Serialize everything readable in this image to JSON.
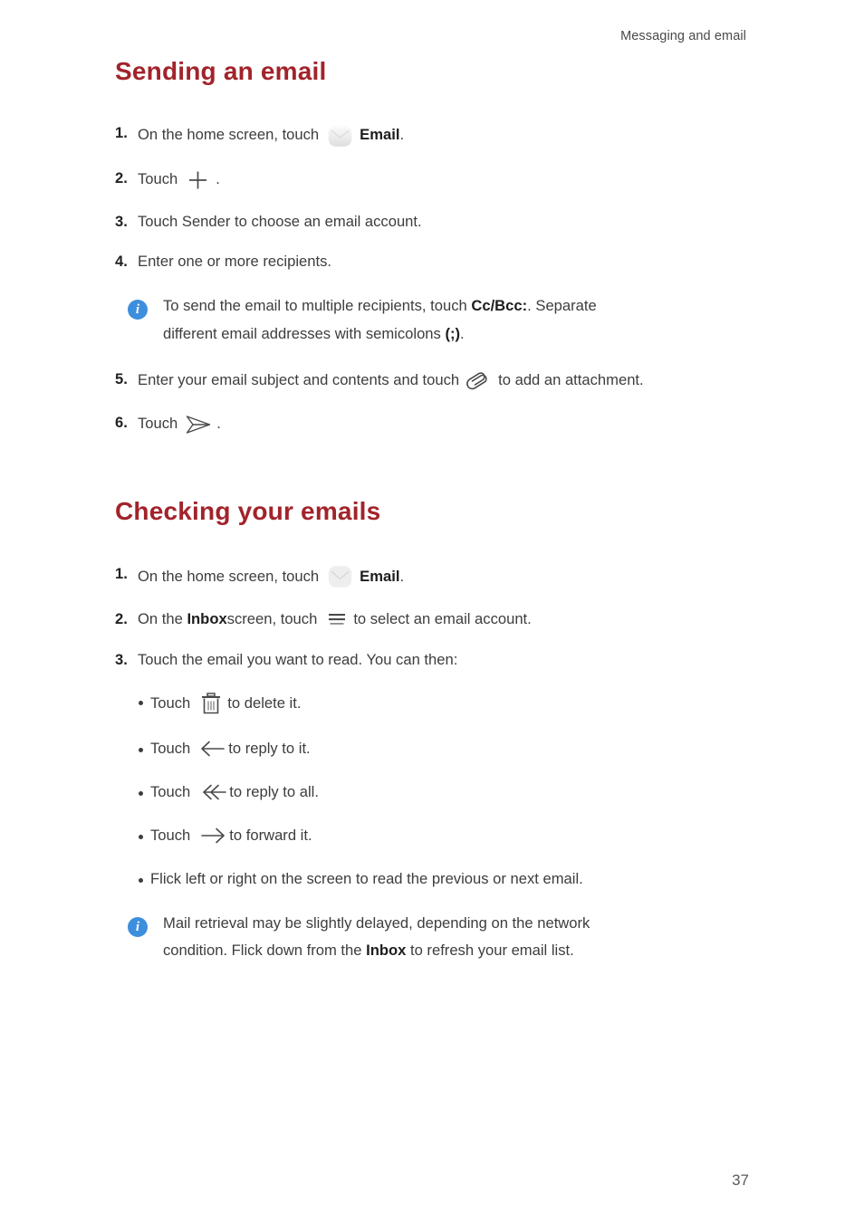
{
  "header": {
    "running_head": "Messaging and email"
  },
  "page": {
    "number": "37"
  },
  "colors": {
    "heading": "#A2232B",
    "body_text": "#3d3d3d",
    "note_icon_bg": "#3E8EDE"
  },
  "sections": [
    {
      "id": "sending-an-email",
      "title": "Sending an email",
      "steps": [
        {
          "num": "1.",
          "parts": [
            {
              "type": "text",
              "value": "On the home screen, touch"
            },
            {
              "type": "icon",
              "name": "email-icon"
            },
            {
              "type": "bold",
              "value": "Email"
            },
            {
              "type": "text",
              "value": "."
            }
          ]
        },
        {
          "num": "2.",
          "parts": [
            {
              "type": "text",
              "value": "Touch"
            },
            {
              "type": "icon",
              "name": "plus-icon"
            },
            {
              "type": "text",
              "value": "."
            }
          ]
        },
        {
          "num": "3.",
          "parts": [
            {
              "type": "text",
              "value": "Touch Sender to choose an email account."
            }
          ]
        },
        {
          "num": "4.",
          "parts": [
            {
              "type": "text",
              "value": "Enter one or more recipients."
            }
          ]
        }
      ],
      "note": {
        "icon": "info-icon",
        "line1_a": "To send the email to multiple recipients, touch ",
        "line1_bold": "Cc/Bcc:",
        "line1_b": ". Separate",
        "line2_a": "different email addresses with semicolons ",
        "line2_bold": "(;)",
        "line2_b": "."
      },
      "steps_after_note": [
        {
          "num": "5.",
          "parts": [
            {
              "type": "text",
              "value": "Enter your email subject and contents and touch"
            },
            {
              "type": "icon",
              "name": "paperclip-icon"
            },
            {
              "type": "text",
              "value": "to add an attachment."
            }
          ]
        },
        {
          "num": "6.",
          "parts": [
            {
              "type": "text",
              "value": "Touch"
            },
            {
              "type": "icon",
              "name": "send-icon"
            },
            {
              "type": "text",
              "value": "."
            }
          ]
        }
      ]
    },
    {
      "id": "checking-your-emails",
      "title": "Checking your emails",
      "steps": [
        {
          "num": "1.",
          "parts": [
            {
              "type": "text",
              "value": "On the home screen, touch"
            },
            {
              "type": "icon",
              "name": "email-icon"
            },
            {
              "type": "bold",
              "value": "Email"
            },
            {
              "type": "text",
              "value": "."
            }
          ]
        },
        {
          "num": "2.",
          "parts": [
            {
              "type": "text",
              "value": "On the "
            },
            {
              "type": "bold",
              "value": "Inbox"
            },
            {
              "type": "text",
              "value": " screen, touch"
            },
            {
              "type": "icon",
              "name": "menu-icon"
            },
            {
              "type": "text",
              "value": "to select an email account."
            }
          ]
        },
        {
          "num": "3.",
          "parts": [
            {
              "type": "text",
              "value": "Touch the email you want to read. You can then:"
            }
          ]
        }
      ],
      "bullets": [
        {
          "pre": "Touch",
          "icon": "trash-icon",
          "post": "to delete it."
        },
        {
          "pre": "Touch",
          "icon": "reply-arrow-icon",
          "post": "to reply to it."
        },
        {
          "pre": "Touch",
          "icon": "reply-all-arrow-icon",
          "post": "to reply to all."
        },
        {
          "pre": "Touch",
          "icon": "forward-arrow-icon",
          "post": "to forward it."
        },
        {
          "pre": "Flick left or right on the screen to read the previous or next email.",
          "icon": "",
          "post": ""
        }
      ],
      "note": {
        "icon": "info-icon",
        "line1_a": "Mail retrieval may be slightly delayed, depending on the network",
        "line1_bold": "",
        "line1_b": "",
        "line2_a": "condition. Flick down from the ",
        "line2_bold": "Inbox",
        "line2_b": " to refresh your email list."
      }
    }
  ]
}
